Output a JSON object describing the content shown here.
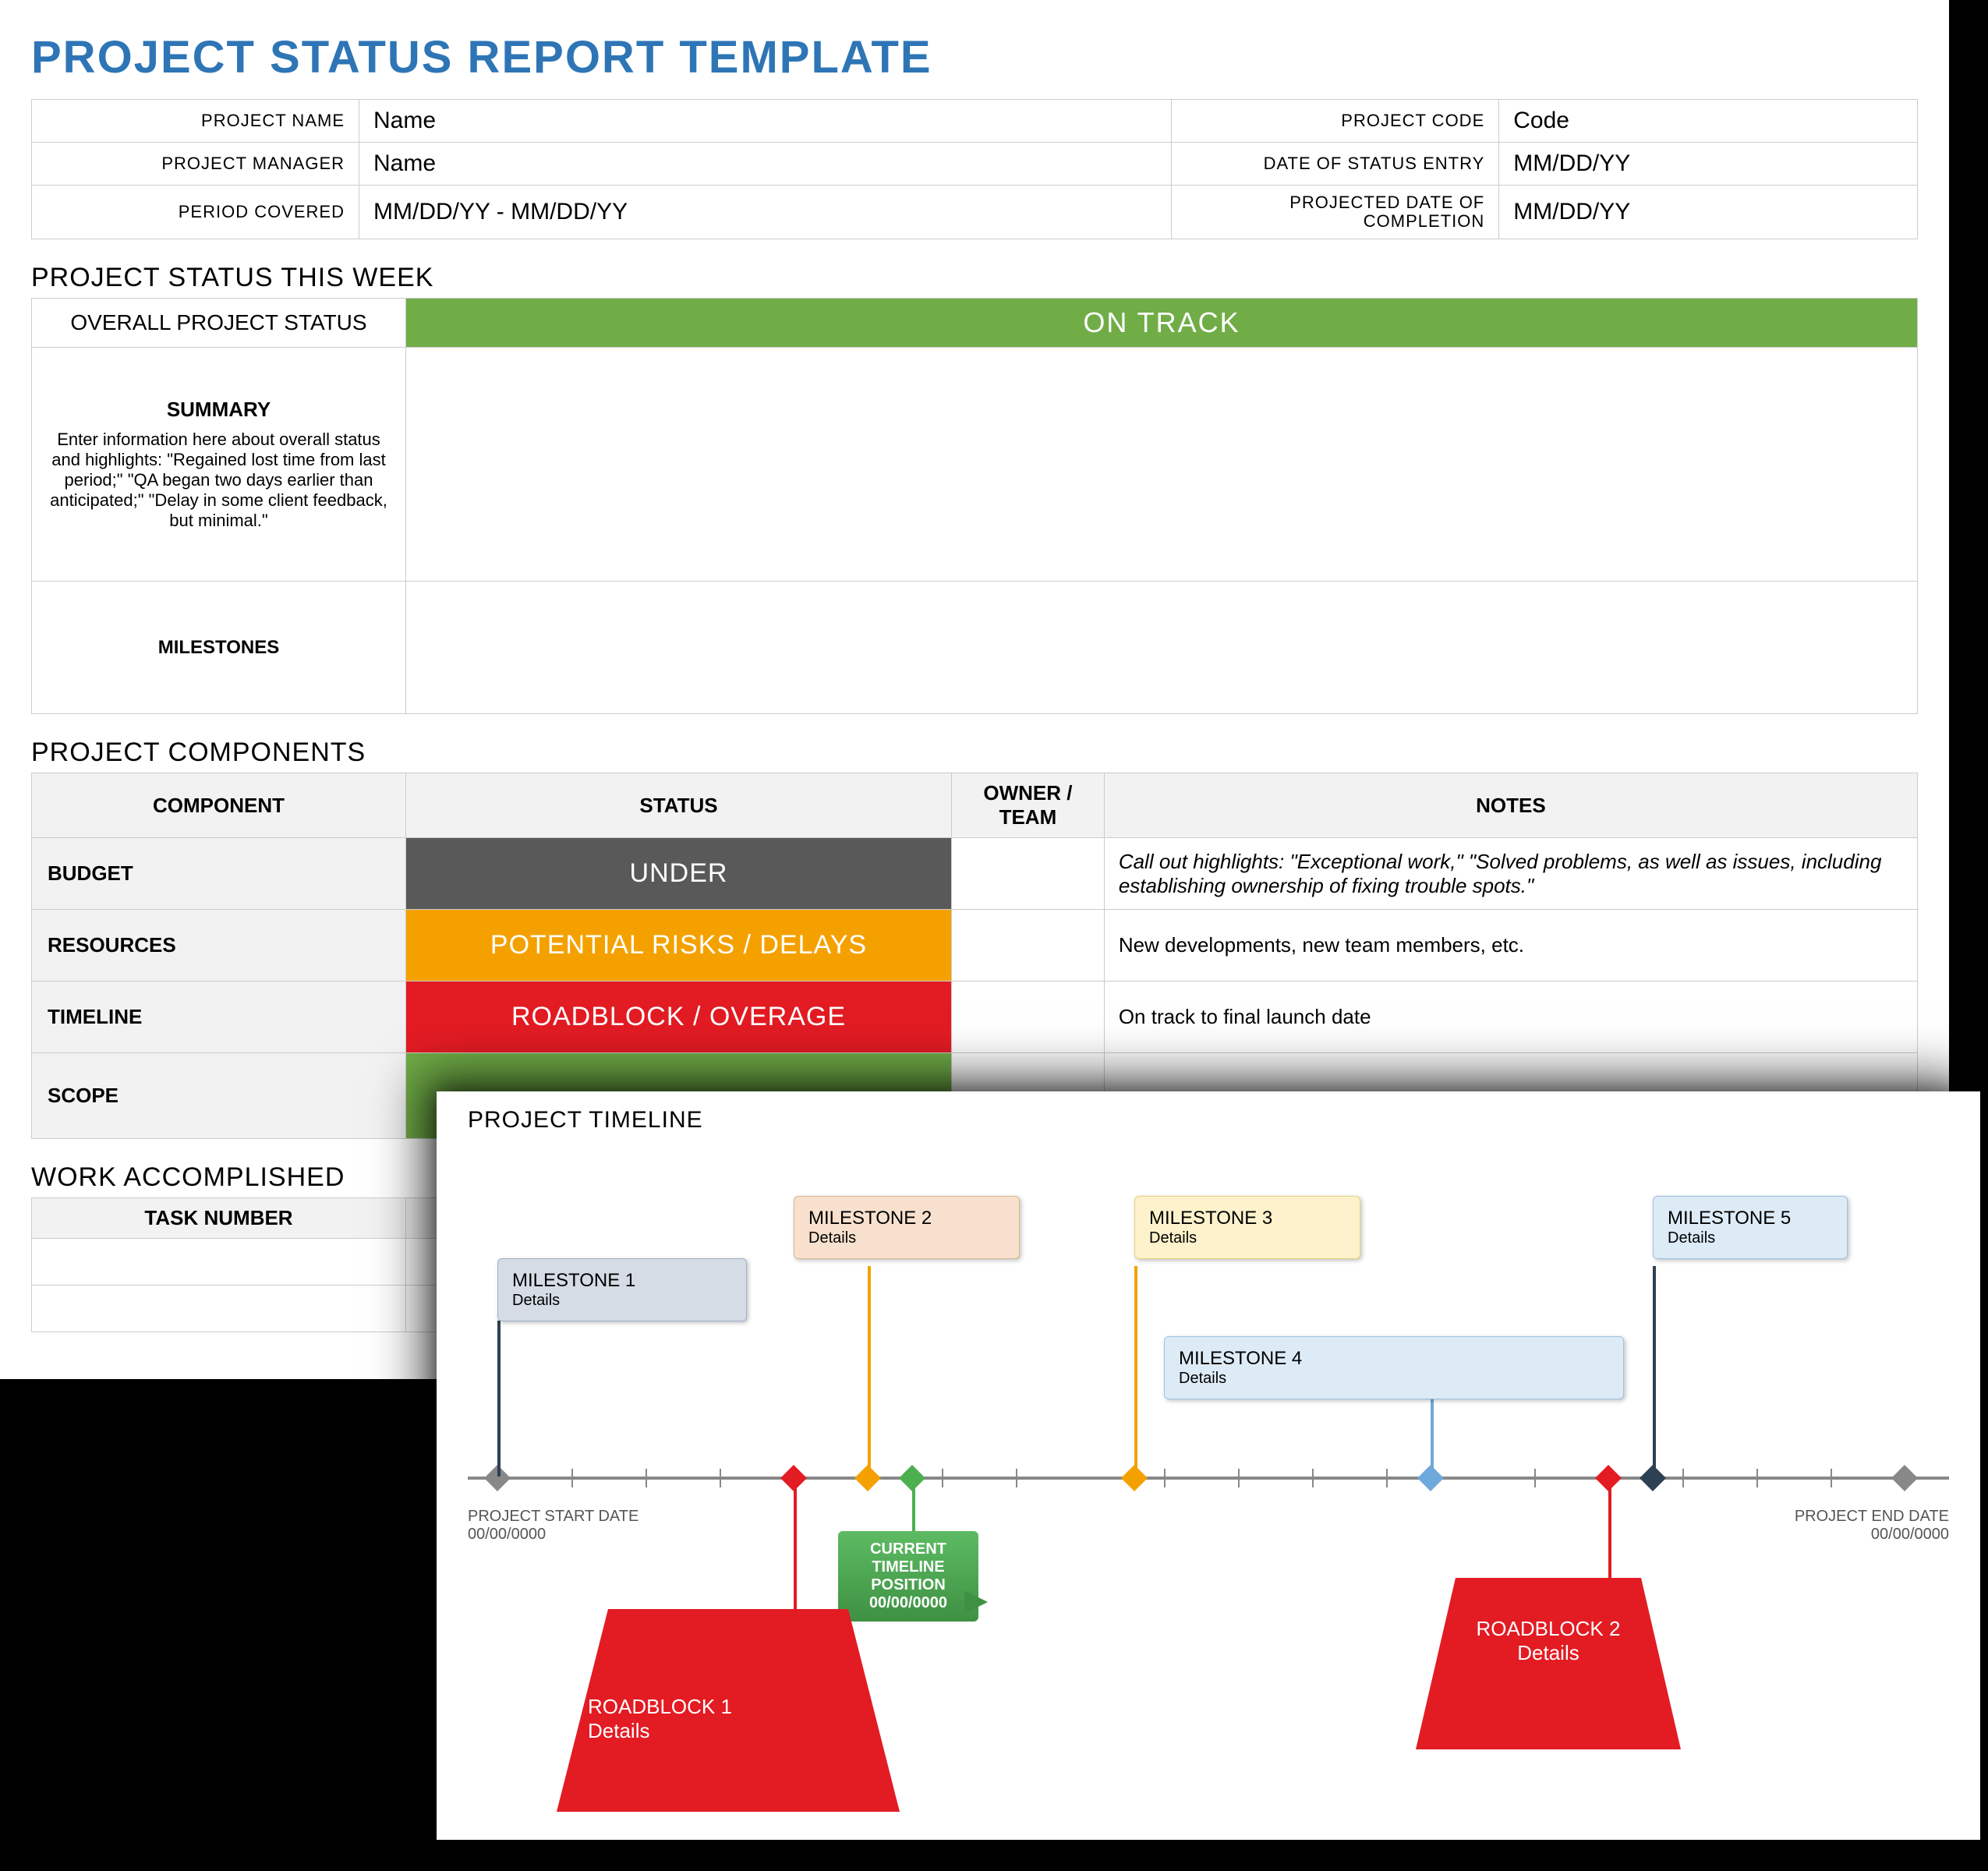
{
  "title": "PROJECT STATUS REPORT TEMPLATE",
  "meta": {
    "project_name_label": "PROJECT NAME",
    "project_name": "Name",
    "project_code_label": "PROJECT CODE",
    "project_code": "Code",
    "project_manager_label": "PROJECT MANAGER",
    "project_manager": "Name",
    "status_date_label": "DATE OF STATUS ENTRY",
    "status_date": "MM/DD/YY",
    "period_label": "PERIOD COVERED",
    "period": "MM/DD/YY - MM/DD/YY",
    "completion_label": "PROJECTED DATE OF COMPLETION",
    "completion": "MM/DD/YY"
  },
  "status_week": {
    "section": "PROJECT STATUS THIS WEEK",
    "overall_label": "OVERALL PROJECT STATUS",
    "overall_value": "ON TRACK",
    "summary_hd": "SUMMARY",
    "summary_text": "Enter information here about overall status and highlights: \"Regained lost time from last period;\" \"QA began two days earlier than anticipated;\" \"Delay in some client feedback, but minimal.\"",
    "milestones_hd": "MILESTONES"
  },
  "components": {
    "section": "PROJECT COMPONENTS",
    "headers": {
      "component": "COMPONENT",
      "status": "STATUS",
      "owner": "OWNER / TEAM",
      "notes": "NOTES"
    },
    "rows": [
      {
        "label": "BUDGET",
        "status": "UNDER",
        "cls": "st-under",
        "notes": "Call out highlights: \"Exceptional work,\" \"Solved problems, as well as issues, including establishing ownership of fixing trouble spots.\""
      },
      {
        "label": "RESOURCES",
        "status": "POTENTIAL RISKS / DELAYS",
        "cls": "st-risk",
        "notes": "New developments, new team members, etc."
      },
      {
        "label": "TIMELINE",
        "status": "ROADBLOCK / OVERAGE",
        "cls": "st-road",
        "notes": "On track to final launch date"
      },
      {
        "label": "SCOPE",
        "status": "",
        "cls": "",
        "notes": ""
      }
    ]
  },
  "work": {
    "section": "WORK ACCOMPLISHED",
    "headers": {
      "task": "TASK NUMBER"
    }
  },
  "timeline": {
    "title": "PROJECT TIMELINE",
    "start_label": "PROJECT START DATE",
    "start_date": "00/00/0000",
    "end_label": "PROJECT END DATE",
    "end_date": "00/00/0000",
    "current_label": "CURRENT TIMELINE POSITION",
    "current_date": "00/00/0000",
    "milestones": [
      {
        "name": "MILESTONE 1",
        "detail": "Details"
      },
      {
        "name": "MILESTONE 2",
        "detail": "Details"
      },
      {
        "name": "MILESTONE 3",
        "detail": "Details"
      },
      {
        "name": "MILESTONE 4",
        "detail": "Details"
      },
      {
        "name": "MILESTONE 5",
        "detail": "Details"
      }
    ],
    "roadblocks": [
      {
        "name": "ROADBLOCK 1",
        "detail": "Details"
      },
      {
        "name": "ROADBLOCK 2",
        "detail": "Details"
      }
    ]
  }
}
